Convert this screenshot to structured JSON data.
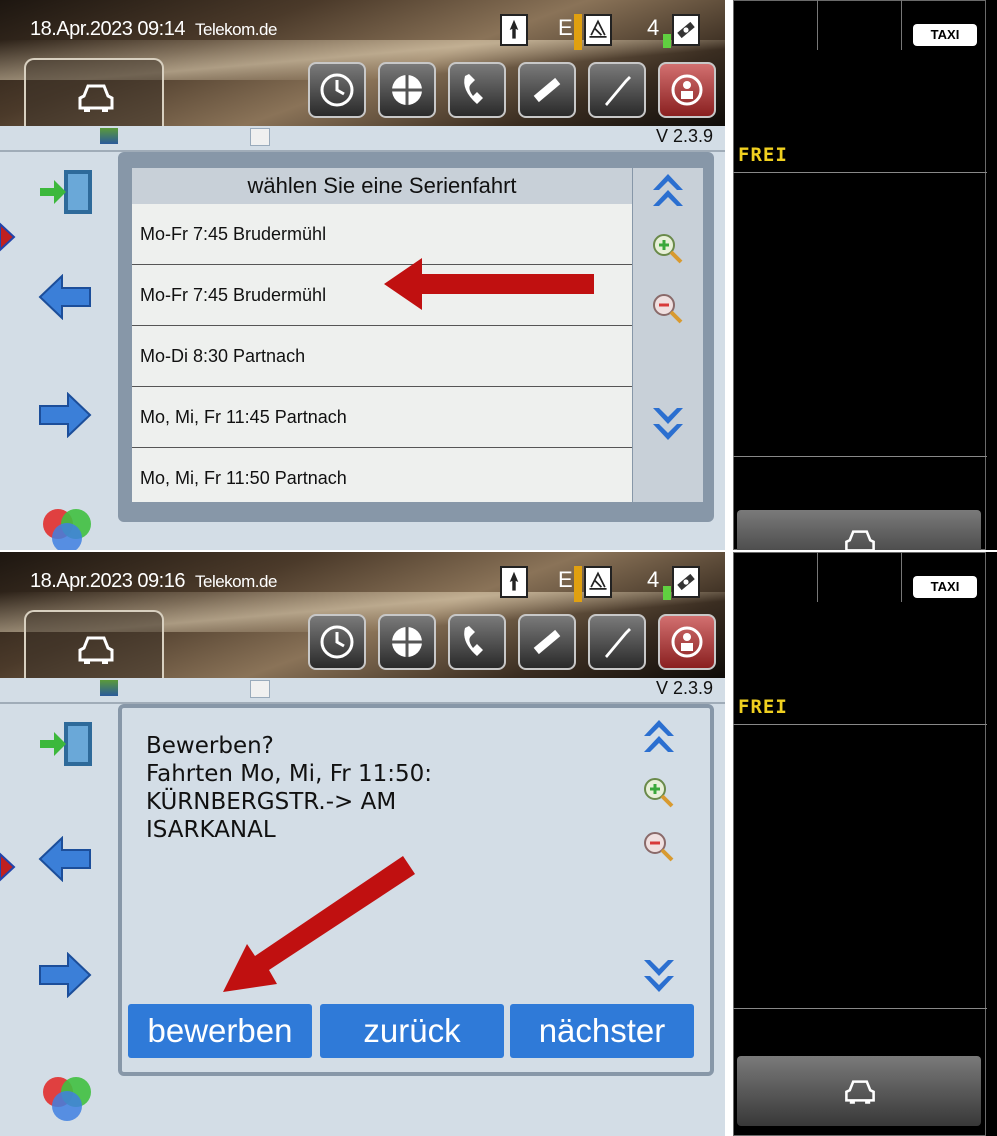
{
  "screens": [
    {
      "status": {
        "datetime": "18.Apr.2023 09:14",
        "carrier": "Telekom.de",
        "signal_letter": "E",
        "count": "4"
      },
      "version": "V 2.3.9",
      "list": {
        "title": "wählen Sie eine Serienfahrt",
        "rows": [
          "Mo-Fr 7:45 Brudermühl",
          "Mo-Fr 7:45 Brudermühl",
          "Mo-Di 8:30 Partnach",
          "Mo, Mi, Fr 11:45 Partnach",
          "Mo, Mi, Fr 11:50 Partnach"
        ]
      },
      "right": {
        "status": "FREI",
        "badge": "TAXI"
      }
    },
    {
      "status": {
        "datetime": "18.Apr.2023 09:16",
        "carrier": "Telekom.de",
        "signal_letter": "E",
        "count": "4"
      },
      "version": "V 2.3.9",
      "dialog": {
        "lines": [
          "Bewerben?",
          "Fahrten Mo, Mi, Fr 11:50:",
          "KÜRNBERGSTR.-> AM",
          "ISARKANAL"
        ],
        "buttons": [
          "bewerben",
          "zurück",
          "nächster"
        ]
      },
      "right": {
        "status": "FREI",
        "badge": "TAXI"
      }
    }
  ],
  "colors": {
    "accent_blue": "#2f7ad8",
    "annotation_red": "#c01010",
    "status_yellow": "#f0d020"
  }
}
